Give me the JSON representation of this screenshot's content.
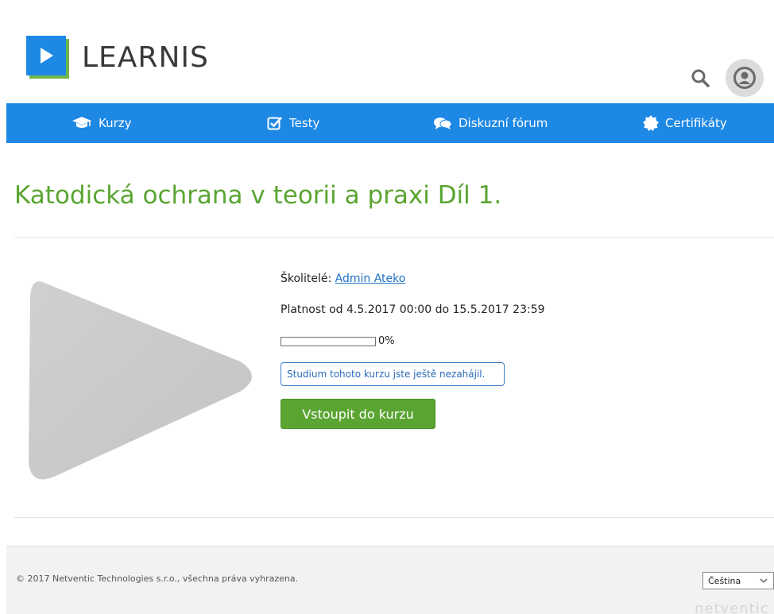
{
  "header": {
    "logo_text": "LEARNIS"
  },
  "nav": {
    "items": [
      {
        "label": "Kurzy",
        "icon": "graduation-cap-icon"
      },
      {
        "label": "Testy",
        "icon": "checkbox-icon"
      },
      {
        "label": "Diskuzní fórum",
        "icon": "chat-bubbles-icon"
      },
      {
        "label": "Certifikáty",
        "icon": "certificate-badge-icon"
      }
    ]
  },
  "course": {
    "title": "Katodická ochrana v teorii a praxi Díl 1.",
    "trainers_label": "Školitelé:",
    "trainer_name": "Admin Ateko",
    "validity": "Platnost od 4.5.2017 00:00 do 15.5.2017 23:59",
    "progress_percent": 0,
    "progress_label": "0%",
    "notice": "Studium tohoto kurzu jste ještě nezahájil.",
    "enter_button": "Vstoupit do kurzu"
  },
  "footer": {
    "copyright": "© 2017 Netventic Technologies s.r.o., všechna práva vyhrazena.",
    "language_selected": "Čeština",
    "brand": "netventic"
  },
  "colors": {
    "primary_blue": "#1e88e5",
    "accent_green": "#5aa532"
  }
}
